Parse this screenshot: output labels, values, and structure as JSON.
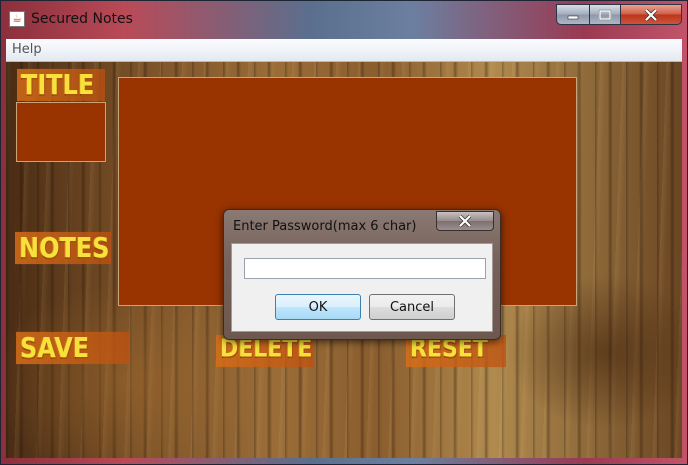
{
  "window": {
    "title": "Secured Notes"
  },
  "menu": {
    "help_label": "Help"
  },
  "labels": {
    "title": "TITLE",
    "notes": "NOTES"
  },
  "buttons": {
    "save": "SAVE",
    "delete": "DELETE",
    "reset": "RESET"
  },
  "fields": {
    "title_value": "",
    "notes_value": ""
  },
  "dialog": {
    "title": "Enter Password(max 6 char)",
    "password_value": "",
    "ok_label": "OK",
    "cancel_label": "Cancel"
  },
  "colors": {
    "field_bg": "#993300",
    "stamp_text": "#f6e23a"
  }
}
